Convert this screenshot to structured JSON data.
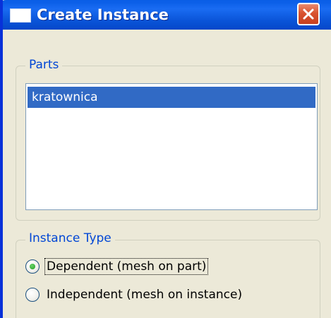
{
  "window": {
    "title": "Create Instance",
    "icon": "window-icon",
    "close_icon": "close-icon"
  },
  "parts": {
    "legend": "Parts",
    "items": [
      "kratownica"
    ],
    "selected_index": 0
  },
  "instance_type": {
    "legend": "Instance Type",
    "options": [
      {
        "label": "Dependent (mesh on part)",
        "checked": true
      },
      {
        "label": "Independent (mesh on instance)",
        "checked": false
      }
    ]
  },
  "colors": {
    "titlebar": "#0a54d8",
    "selection": "#316ac5",
    "legend_text": "#0046d5",
    "dialog_bg": "#ece9d8"
  }
}
